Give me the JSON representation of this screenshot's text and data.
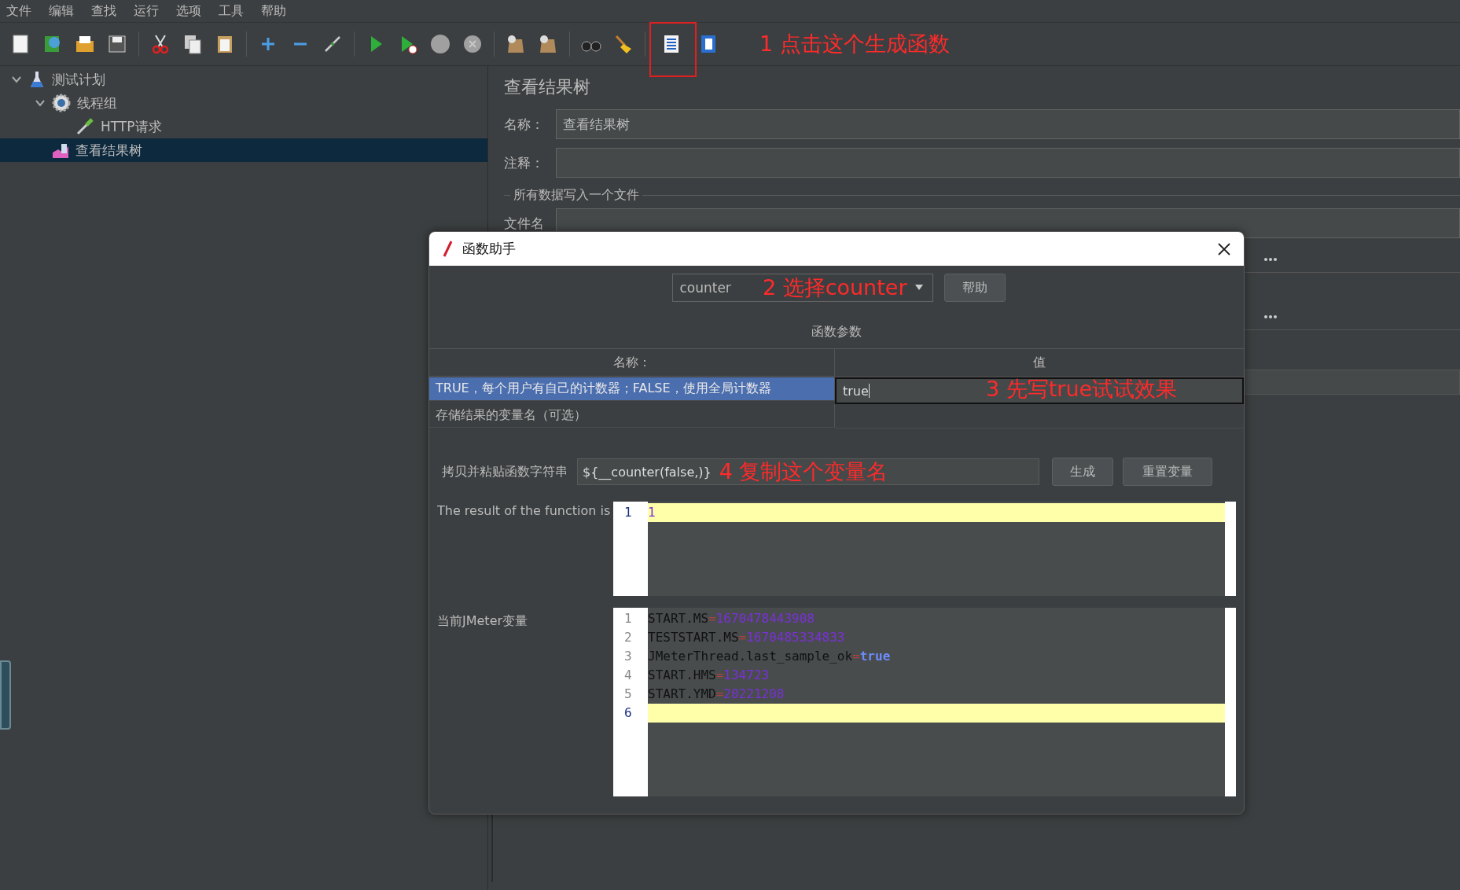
{
  "menu": [
    "文件",
    "编辑",
    "查找",
    "运行",
    "选项",
    "工具",
    "帮助"
  ],
  "toolbar": {
    "note": "1 点击这个生成函数"
  },
  "tree": [
    {
      "label": "测试计划",
      "kind": "plan",
      "expanded": true,
      "selected": false,
      "children": [
        {
          "label": "线程组",
          "kind": "threads",
          "expanded": true,
          "selected": false,
          "children": [
            {
              "label": "HTTP请求",
              "kind": "sampler",
              "selected": false
            }
          ]
        },
        {
          "label": "查看结果树",
          "kind": "listener",
          "selected": true
        }
      ]
    }
  ],
  "panel": {
    "title": "查看结果树",
    "name_label": "名称：",
    "name_value": "查看结果树",
    "comment_label": "注释：",
    "group_title": "所有数据写入一个文件",
    "file_label": "文件名"
  },
  "dialog": {
    "title": "函数助手",
    "function": "counter",
    "function_note": "2 选择counter",
    "help_button": "帮助",
    "params_title": "函数参数",
    "columns": [
      "名称：",
      "值"
    ],
    "params": [
      {
        "name": "TRUE，每个用户有自己的计数器；FALSE，使用全局计数器",
        "value": "true",
        "note": "3 先写true试试效果",
        "selected": true
      },
      {
        "name": "存储结果的变量名（可选）",
        "selected": false
      }
    ],
    "copy_label": "拷贝并粘贴函数字符串",
    "function_string": "${__counter(false,)}",
    "function_string_note": "4 复制这个变量名",
    "generate_button": "生成",
    "reset_button": "重置变量",
    "result_label": "The result of the function is",
    "result_lines": [
      {
        "number": "1",
        "text": "1",
        "current": true
      }
    ],
    "vars_label": "当前JMeter变量",
    "vars_lines": [
      {
        "number": "1",
        "key": "START.MS",
        "sep": "=",
        "value": "1670478443908",
        "kind": "number",
        "current": false
      },
      {
        "number": "2",
        "key": "TESTSTART.MS",
        "sep": "=",
        "value": "1670485334833",
        "kind": "number",
        "current": false
      },
      {
        "number": "3",
        "key": "JMeterThread.last_sample_ok",
        "sep": "=",
        "value": "true",
        "kind": "keyword",
        "current": false
      },
      {
        "number": "4",
        "key": "START.HMS",
        "sep": "=",
        "value": "134723",
        "kind": "number",
        "current": false
      },
      {
        "number": "5",
        "key": "START.YMD",
        "sep": "=",
        "value": "20221208",
        "kind": "number",
        "current": false
      },
      {
        "number": "6",
        "current": true
      }
    ]
  }
}
